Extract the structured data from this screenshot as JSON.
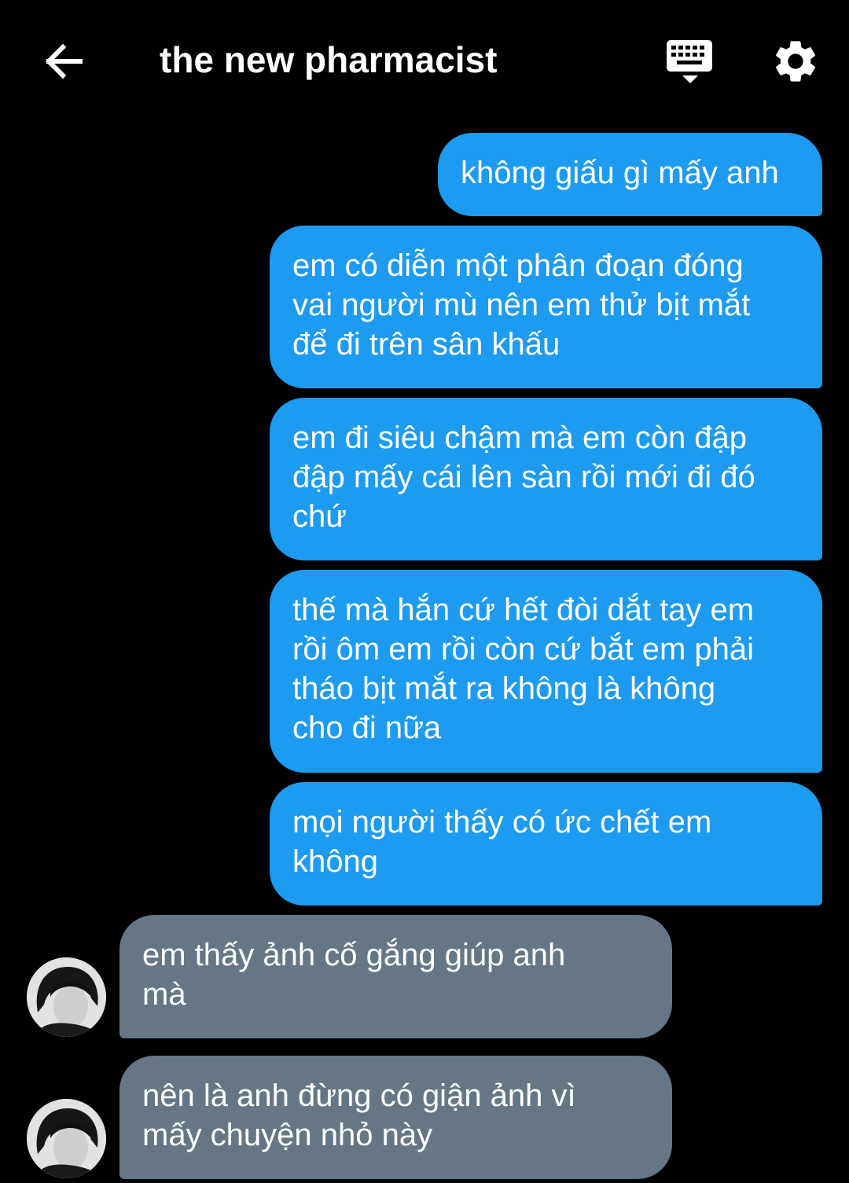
{
  "header": {
    "title": "the new pharmacist",
    "back_icon": "arrow-left-icon",
    "keyboard_icon": "keyboard-icon",
    "settings_icon": "gear-icon"
  },
  "colors": {
    "background": "#000000",
    "outgoing_bubble": "#1d9bf0",
    "incoming_bubble": "#657786",
    "text": "#ffffff"
  },
  "messages": [
    {
      "direction": "outgoing",
      "lines": [
        "không giấu gì mấy anh"
      ]
    },
    {
      "direction": "outgoing",
      "lines": [
        "em có diễn một phân đoạn đóng",
        "vai người mù nên em thử bịt mắt",
        "để đi trên sân khấu"
      ]
    },
    {
      "direction": "outgoing",
      "lines": [
        "em đi siêu chậm mà em còn đập",
        "đập mấy cái lên sàn rồi mới đi đó",
        "chứ"
      ]
    },
    {
      "direction": "outgoing",
      "lines": [
        "thế mà hắn cứ hết đòi dắt tay em",
        "rồi ôm em rồi còn cứ bắt em phải",
        "tháo bịt mắt ra không là không",
        "cho đi nữa"
      ]
    },
    {
      "direction": "outgoing",
      "lines": [
        "mọi người thấy có ức chết em",
        "không"
      ]
    },
    {
      "direction": "incoming",
      "lines": [
        "em thấy ảnh cố gắng giúp anh",
        "mà"
      ]
    },
    {
      "direction": "incoming",
      "lines": [
        "nên là anh đừng có giận ảnh vì",
        "mấy chuyện nhỏ này"
      ]
    }
  ]
}
